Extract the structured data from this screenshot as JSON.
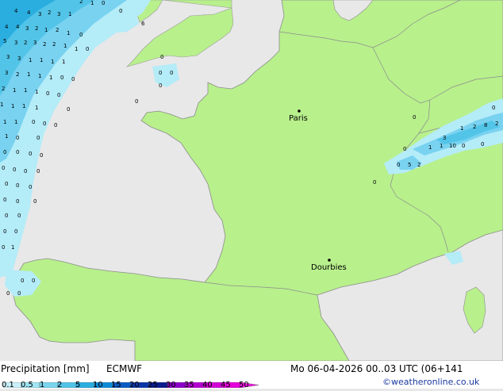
{
  "map": {
    "cities": [
      {
        "name": "Paris"
      },
      {
        "name": "Dourbies"
      }
    ]
  },
  "footer": {
    "left_title": "Precipitation [mm]",
    "model": "ECMWF",
    "datetime": "Mo 06-04-2026 00..03 UTC (06+141",
    "credit": "©weatheronline.co.uk",
    "legend_ticks": [
      "0.1",
      "0.5",
      "1",
      "2",
      "5",
      "10",
      "15",
      "20",
      "25",
      "30",
      "35",
      "40",
      "45",
      "50"
    ],
    "legend_colors": [
      "#c8f0f8",
      "#a0e6f4",
      "#7ad6ee",
      "#52c4e8",
      "#2aaee0",
      "#0c8cd8",
      "#0a5ac4",
      "#0a36a8",
      "#0a1c8c",
      "#8c00c8",
      "#b400d0",
      "#d200d6",
      "#e600da",
      "#f014e0"
    ]
  },
  "colors": {
    "sea": "#e8e8e8",
    "land": "#b8f08c",
    "border": "#8c8c8c",
    "rain_light": "#b4ecf8",
    "rain_mid": "#78d2f0",
    "rain_heavy": "#3ca8e4"
  }
}
